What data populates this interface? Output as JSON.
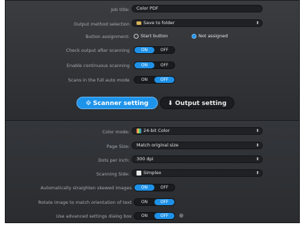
{
  "job_title": {
    "label": "Job title:",
    "value": "Color PDF"
  },
  "output_method": {
    "label": "Output method selection",
    "value": "Save to folder"
  },
  "button_assignment": {
    "label": "Button assignment:",
    "start": "Start button",
    "not_assigned": "Not assigned",
    "selected": "Not assigned"
  },
  "check_output": {
    "label": "Check output after scanning",
    "on": "ON",
    "off": "OFF",
    "state": "ON"
  },
  "continuous_scanning": {
    "label": "Enable continuous scanning",
    "on": "ON",
    "off": "OFF",
    "state": "ON"
  },
  "full_auto": {
    "label": "Scans in the full auto mode",
    "on": "ON",
    "off": "OFF",
    "state": "OFF"
  },
  "tabs": {
    "scanner": "Scanner setting",
    "output": "Output setting",
    "active": "Scanner setting"
  },
  "color_mode": {
    "label": "Color mode:",
    "value": "24-bit Color"
  },
  "page_size": {
    "label": "Page Size:",
    "value": "Match original size"
  },
  "dpi": {
    "label": "Dots per inch:",
    "value": "300 dpi"
  },
  "scanning_side": {
    "label": "Scanning Side:",
    "value": "Simplex"
  },
  "straighten": {
    "label": "Automatically straighten skewed images",
    "on": "ON",
    "off": "OFF",
    "state": "ON"
  },
  "rotate": {
    "label": "Rotate image to match orientation of text",
    "on": "ON",
    "off": "OFF",
    "state": "OFF"
  },
  "advanced": {
    "label": "Use advanced settings dialog box",
    "on": "ON",
    "off": "OFF",
    "state": "OFF"
  },
  "colors": {
    "accent": "#1f92e8",
    "panel": "#2f3135"
  }
}
